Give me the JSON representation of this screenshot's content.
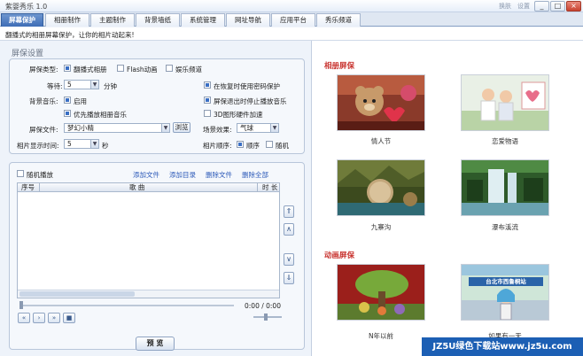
{
  "app": {
    "title": "紫婴秀乐 1.0",
    "link_skin": "换肤",
    "link_settings": "设置"
  },
  "window_controls": {
    "min": "_",
    "max": "□",
    "close": "×"
  },
  "tabs": [
    "屏幕保护",
    "相册制作",
    "主题制作",
    "背景墙纸",
    "系统管理",
    "网址导航",
    "应用平台",
    "秀乐频道"
  ],
  "info_text": "翻播式的相册屏幕保护，让你的相片动起来!",
  "settings": {
    "section_title": "屏保设置",
    "saver_type_label": "屏保类型:",
    "saver_type_options": [
      "翻播式相册",
      "Flash动画",
      "娱乐频道"
    ],
    "wait_label": "等待:",
    "wait_value": "5",
    "wait_unit": "分钟",
    "password_label": "在恢复时使用密码保护",
    "bg_music_label": "背景音乐:",
    "enable_label": "启用",
    "stop_music_label": "屏保退出时停止播放音乐",
    "priority_music_label": "优先播放相册音乐",
    "hw_accel_label": "3D图形硬件加速",
    "saver_file_label": "屏保文件:",
    "saver_file_value": "梦幻小精",
    "browse_label": "浏览",
    "scene_effect_label": "场景效果:",
    "scene_effect_value": "气球",
    "photo_time_label": "相片显示时间:",
    "photo_time_value": "5",
    "photo_time_unit": "秒",
    "photo_order_label": "相片顺序:",
    "order_sequential": "顺序",
    "order_random": "随机"
  },
  "playlist": {
    "random_play_label": "随机播放",
    "add_file": "添加文件",
    "add_dir": "添加目录",
    "del_file": "删除文件",
    "del_all": "删除全部",
    "col_no": "序号",
    "col_song": "歌  曲",
    "col_time": "时 长",
    "time_display": "0:00 / 0:00",
    "preview_label": "预 览"
  },
  "gallery": {
    "photo_album_title": "相册屏保",
    "photo_items": [
      "情人节",
      "恋爱物语",
      "九寨沟",
      "瀑布溪流"
    ],
    "animation_title": "动画屏保",
    "animation_items": [
      "N年以前",
      "如果有一天"
    ],
    "animation_sign_text": "台北市西鲁桐站"
  },
  "watermark": "JZ5U绿色下载站www.jz5u.com",
  "colors": {
    "accent": "#3e6db6",
    "category_red": "#c8322e",
    "link_blue": "#2a58b8"
  }
}
